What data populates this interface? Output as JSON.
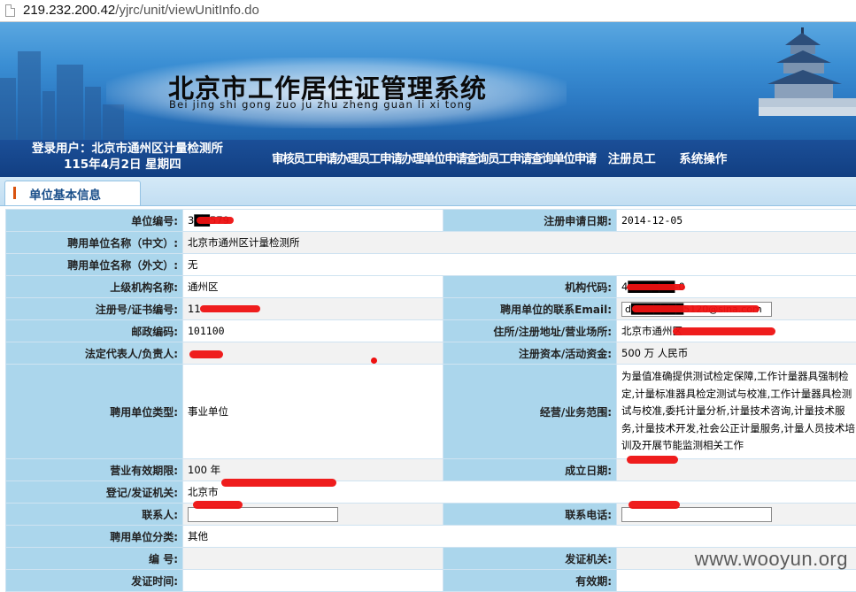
{
  "address_bar": {
    "host": "219.232.200.42",
    "path": "/yjrc/unit/viewUnitInfo.do"
  },
  "banner": {
    "title": "北京市工作居住证管理系统",
    "pinyin": "Bei jing shi gong zuo ju zhu zheng guan li xi tong"
  },
  "header": {
    "login_text": "登录用户：北京市通州区计量检测所",
    "date_text": "115年4月2日  星期四"
  },
  "nav": {
    "items": [
      "审核员工申请",
      "办理员工申请",
      "办理单位申请",
      "查询员工申请",
      "查询单位申请",
      "注册员工",
      "系统操作"
    ]
  },
  "tab": {
    "label": "单位基本信息"
  },
  "form": {
    "unit_no_label": "单位编号:",
    "unit_no": "3██579",
    "reg_date_label": "注册申请日期:",
    "reg_date": "2014-12-05",
    "name_cn_label": "聘用单位名称（中文）:",
    "name_cn": "北京市通州区计量检测所",
    "name_en_label": "聘用单位名称（外文）:",
    "name_en": "无",
    "parent_org_label": "上级机构名称:",
    "parent_org": "通州区",
    "org_code_label": "机构代码:",
    "org_code": "4██████-0",
    "reg_no_label": "注册号/证书编号:",
    "reg_no": "11",
    "email_label": "聘用单位的联系Email:",
    "email": "d███████5120@sina.com",
    "postcode_label": "邮政编码:",
    "postcode": "101100",
    "address_label": "住所/注册地址/营业场所:",
    "address": "北京市通州区",
    "legal_rep_label": "法定代表人/负责人:",
    "legal_rep": "",
    "capital_label": "注册资本/活动资金:",
    "capital": "500   万     人民币",
    "unit_type_label": "聘用单位类型:",
    "unit_type": "事业单位",
    "business_label": "经营/业务范围:",
    "business": "为量值准确提供测试检定保障,工作计量器具强制检定,计量标准器具检定测试与校准,工作计量器具检测试与校准,委托计量分析,计量技术咨询,计量技术服务,计量技术开发,社会公正计量服务,计量人员技术培训及开展节能监测相关工作",
    "validity_label": "营业有效期限:",
    "validity": "100    年",
    "found_date_label": "成立日期:",
    "found_date": "",
    "reg_authority_label": "登记/发证机关:",
    "reg_authority": "北京市",
    "contact_label": "联系人:",
    "contact": "",
    "phone_label": "联系电话:",
    "phone": "",
    "category_label": "聘用单位分类:",
    "category": "其他",
    "number_label": "编     号:",
    "number": "",
    "issuer_label": "发证机关:",
    "issuer": "",
    "issue_time_label": "发证时间:",
    "issue_time": "",
    "expiry_label": "有效期:",
    "expiry": ""
  },
  "watermark": "www.wooyun.org"
}
